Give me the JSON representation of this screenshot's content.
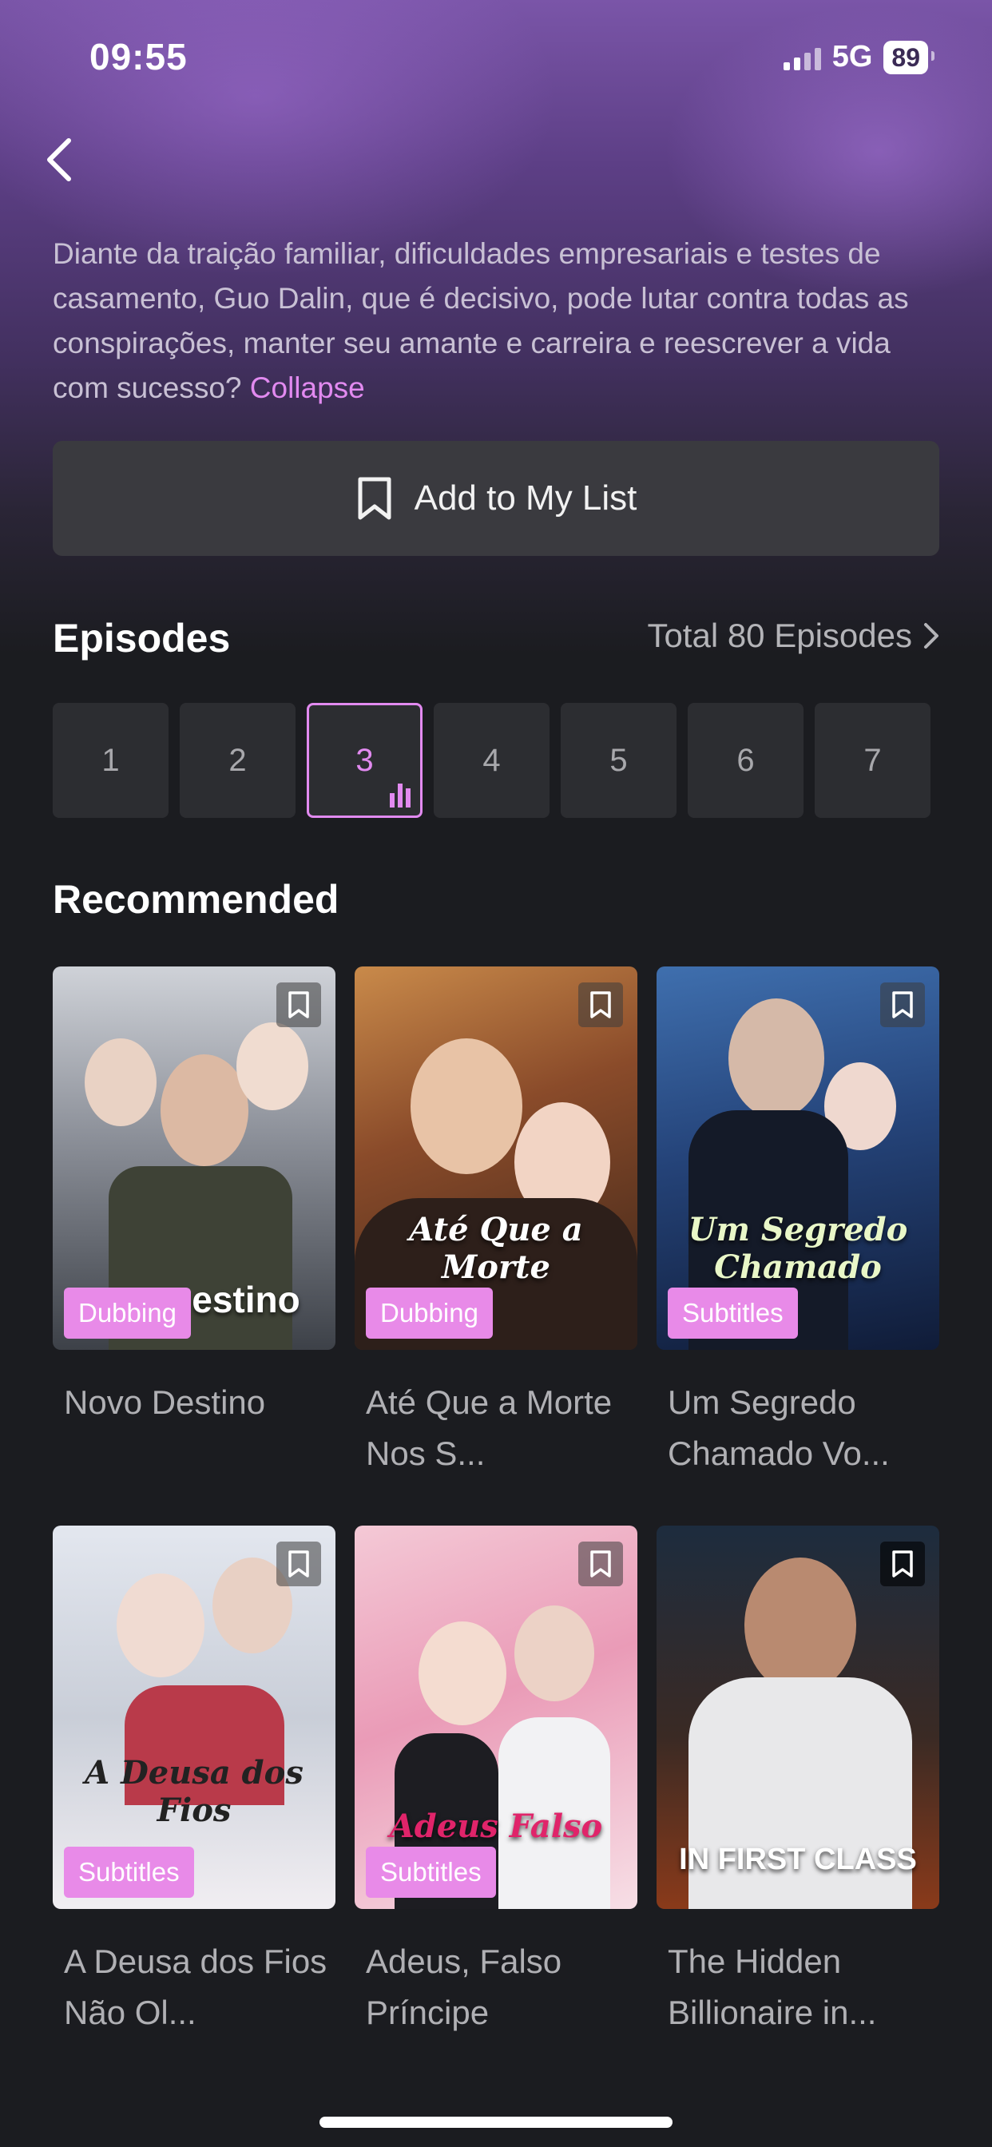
{
  "status": {
    "time": "09:55",
    "network": "5G",
    "battery": "89"
  },
  "description": {
    "text": "Diante da traição familiar, dificuldades empresariais e testes de casamento, Guo Dalin, que é decisivo, pode lutar contra todas as conspirações, manter seu amante e carreira e reescrever a vida com sucesso? ",
    "collapse_label": "Collapse"
  },
  "my_list": {
    "label": "Add to My List"
  },
  "episodes": {
    "title": "Episodes",
    "total_label": "Total 80 Episodes",
    "items": [
      "1",
      "2",
      "3",
      "4",
      "5",
      "6",
      "7"
    ],
    "active": "3"
  },
  "recommended": {
    "title": "Recommended",
    "items": [
      {
        "title": "Novo Destino",
        "badge": "Dubbing",
        "poster_text": "estino"
      },
      {
        "title": "Até Que a Morte Nos S...",
        "badge": "Dubbing",
        "poster_text": "Até Que a Morte"
      },
      {
        "title": "Um Segredo Chamado Vo...",
        "badge": "Subtitles",
        "poster_text": "Um Segredo Chamado"
      },
      {
        "title": "A Deusa dos Fios Não Ol...",
        "badge": "Subtitles",
        "poster_text": "A Deusa dos Fios"
      },
      {
        "title": "Adeus, Falso Príncipe",
        "badge": "Subtitles",
        "poster_text": "Adeus Falso"
      },
      {
        "title": "The Hidden Billionaire in...",
        "badge": "",
        "poster_text": "IN FIRST CLASS"
      }
    ]
  },
  "colors": {
    "accent": "#e28af0",
    "badge": "#e88ae8",
    "background": "#1b1c20"
  }
}
